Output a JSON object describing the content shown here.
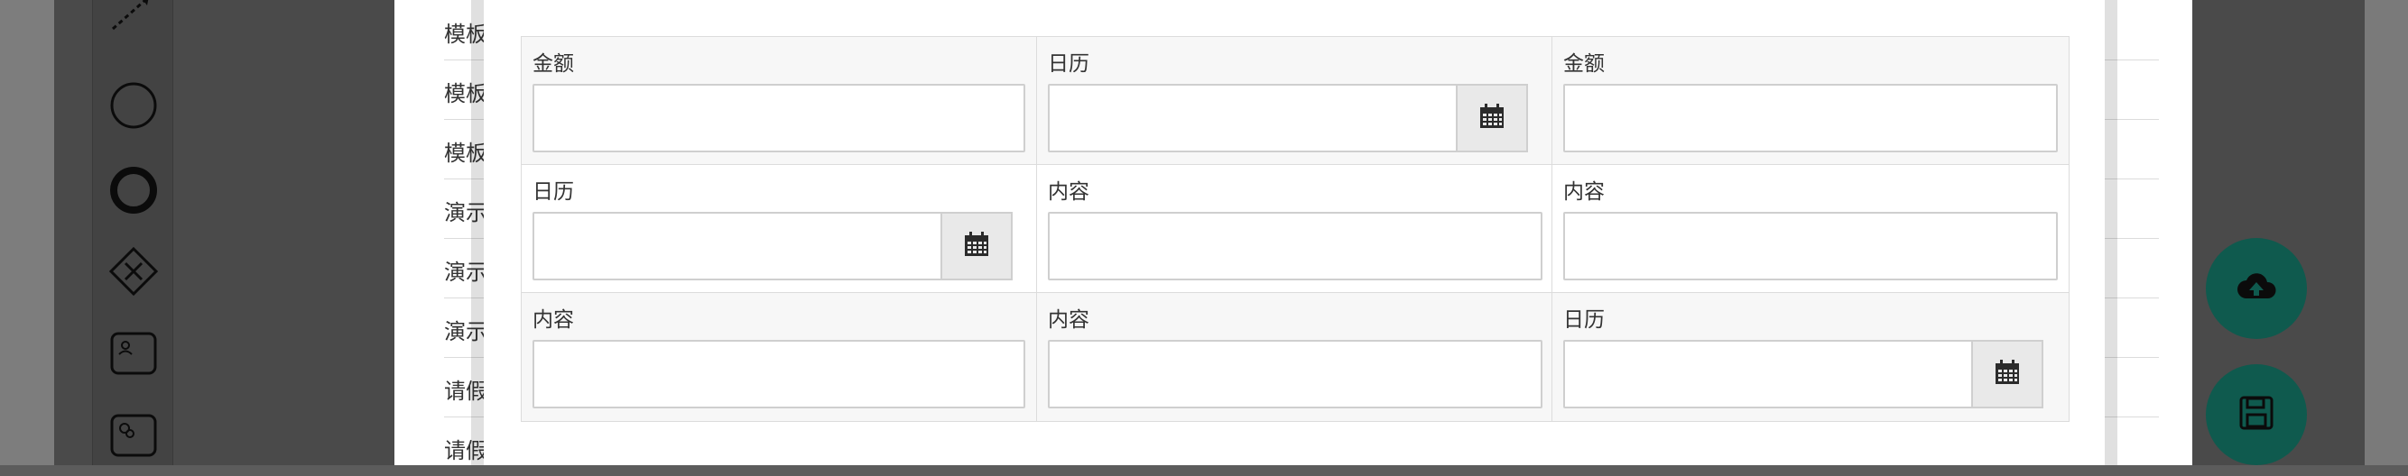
{
  "list": {
    "rows": [
      {
        "text": "模板"
      },
      {
        "text": "模板"
      },
      {
        "text": "模板"
      },
      {
        "text": "演示"
      },
      {
        "text": "演示"
      },
      {
        "text": "演示"
      },
      {
        "text": "请假"
      },
      {
        "text": "请假"
      }
    ]
  },
  "palette": {
    "tools": [
      {
        "icon": "connector-arrow-icon"
      },
      {
        "icon": "start-event-icon"
      },
      {
        "icon": "end-event-icon"
      },
      {
        "icon": "gateway-icon"
      },
      {
        "icon": "user-task-icon"
      },
      {
        "icon": "service-task-icon"
      }
    ]
  },
  "form": {
    "rows": [
      {
        "cells": [
          {
            "label": "金额",
            "type": "text",
            "value": ""
          },
          {
            "label": "日历",
            "type": "date",
            "value": ""
          },
          {
            "label": "金额",
            "type": "text",
            "value": ""
          }
        ]
      },
      {
        "cells": [
          {
            "label": "日历",
            "type": "date",
            "value": ""
          },
          {
            "label": "内容",
            "type": "text",
            "value": ""
          },
          {
            "label": "内容",
            "type": "text",
            "value": ""
          }
        ]
      },
      {
        "cells": [
          {
            "label": "内容",
            "type": "text",
            "value": ""
          },
          {
            "label": "内容",
            "type": "text",
            "value": ""
          },
          {
            "label": "日历",
            "type": "date",
            "value": ""
          }
        ]
      }
    ]
  },
  "fabs": [
    {
      "icon": "cloud-upload-icon"
    },
    {
      "icon": "save-icon"
    }
  ],
  "colors": {
    "fab": "#0f5a4e",
    "overlay": "#4a4a4a",
    "border": "#dcdcdc"
  }
}
